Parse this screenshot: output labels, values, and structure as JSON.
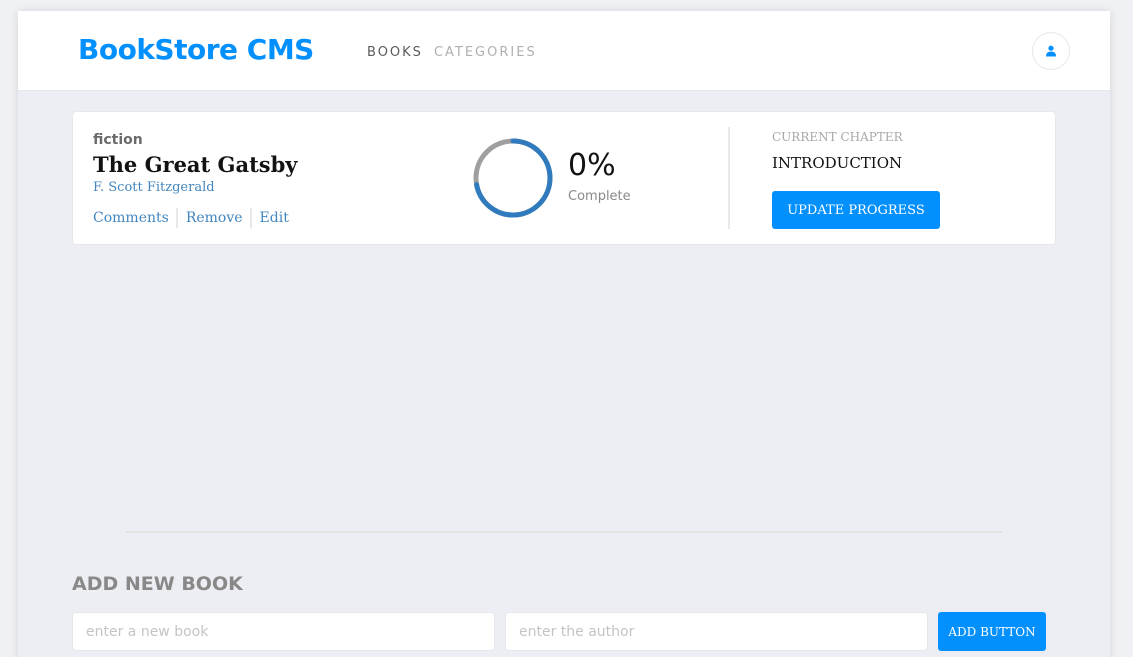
{
  "header": {
    "logo": "BookStore CMS",
    "nav": [
      {
        "label": "BOOKS"
      },
      {
        "label": "CATEGORIES"
      }
    ],
    "avatar_icon": "user-icon"
  },
  "colors": {
    "accent": "#0290ff",
    "progress_ring": "#307bbe",
    "progress_track": "#e8e8e8"
  },
  "book": {
    "genre": "fiction",
    "title": "The Great Gatsby",
    "author": "F. Scott Fitzgerald",
    "actions": [
      "Comments",
      "Remove",
      "Edit"
    ],
    "percent_value": 0,
    "percent_text": "0%",
    "complete_label": "Complete",
    "chapter_label": "CURRENT CHAPTER",
    "chapter_name": "INTRODUCTION",
    "update_label": "UPDATE PROGRESS"
  },
  "form": {
    "title": "ADD NEW BOOK",
    "book_placeholder": "enter a new book",
    "author_placeholder": "enter the author",
    "add_label": "ADD BUTTON"
  }
}
